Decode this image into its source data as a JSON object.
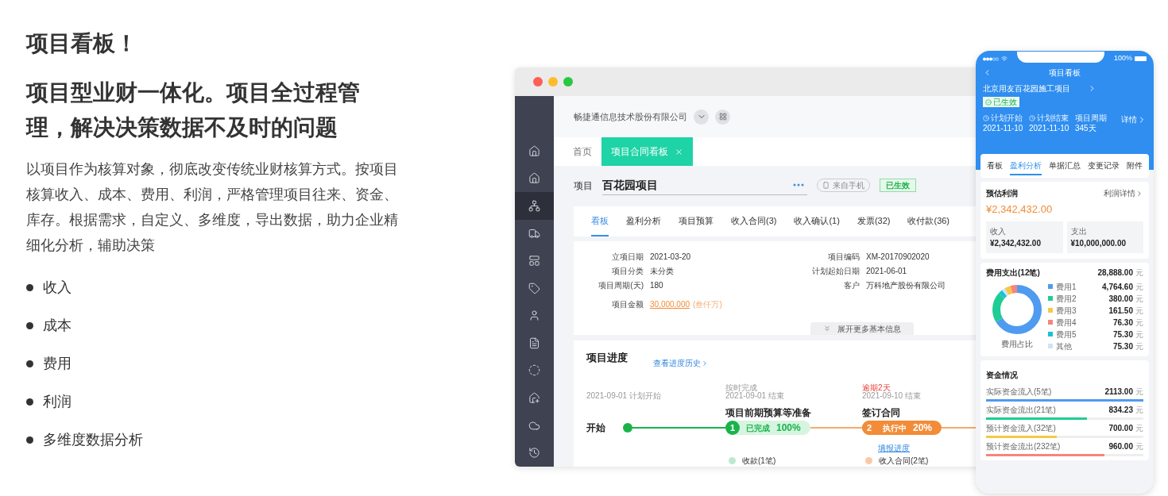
{
  "intro": {
    "title": "项目看板！",
    "subtitle": "项目型业财一体化。项目全过程管理，解决决策数据不及时的问题",
    "description": "以项目作为核算对象，彻底改变传统业财核算方式。按项目核算收入、成本、费用、利润，严格管理项目往来、资金、库存。根据需求，自定义、多维度，导出数据，助力企业精细化分析，辅助决策",
    "bullets": [
      "收入",
      "成本",
      "费用",
      "利润",
      "多维度数据分析"
    ]
  },
  "desktop": {
    "company": "畅捷通信息技术股份有限公司",
    "sidebar": [
      {
        "selected": false
      },
      {
        "selected": false
      },
      {
        "selected": true
      },
      {
        "selected": false
      },
      {
        "selected": false
      },
      {
        "selected": false
      },
      {
        "selected": false
      },
      {
        "selected": false
      },
      {
        "selected": false
      },
      {
        "selected": false
      },
      {
        "selected": false
      },
      {
        "selected": false
      }
    ],
    "tabs": [
      {
        "label": "首页",
        "selected": false,
        "closable": false
      },
      {
        "label": "项目合同看板",
        "selected": true,
        "closable": true
      }
    ],
    "project": {
      "label": "项目",
      "name": "百花园项目",
      "source": "来自手机",
      "status": "已生效"
    },
    "sections": [
      {
        "label": "看板",
        "selected": true
      },
      {
        "label": "盈利分析",
        "selected": false
      },
      {
        "label": "项目预算",
        "selected": false
      },
      {
        "label": "收入合同(3)",
        "selected": false
      },
      {
        "label": "收入确认(1)",
        "selected": false
      },
      {
        "label": "发票(32)",
        "selected": false
      },
      {
        "label": "收付款(36)",
        "selected": false
      }
    ],
    "left_fields": [
      {
        "label": "立项日期",
        "value": "2021-03-20"
      },
      {
        "label": "项目分类",
        "value": "未分类"
      },
      {
        "label": "项目周期(天)",
        "value": "180"
      }
    ],
    "amount": {
      "label": "项目金额",
      "value": "30,000,000",
      "note": "(叁仟万)"
    },
    "right_fields": [
      {
        "label": "项目编码",
        "value": "XM-20170902020"
      },
      {
        "label": "计划起始日期",
        "value": "2021-06-01"
      },
      {
        "label": "客户",
        "value": "万科地产股份有限公司"
      }
    ],
    "expand": "展开更多基本信息",
    "progress": {
      "title": "项目进度",
      "history_link": "查看进度历史",
      "stages": [
        {
          "kind": "start",
          "date": "2021-09-01 计划开始",
          "name": "开始"
        },
        {
          "kind": "done",
          "number": "1",
          "note": "按时完成",
          "date": "2021-09-01 结束",
          "name": "项目前期预算等准备",
          "state": "已完成",
          "percent": "100%",
          "sub": "收款(1笔)"
        },
        {
          "kind": "active",
          "number": "2",
          "note": "逾期2天",
          "date": "2021-09-10 结束",
          "name": "签订合同",
          "state": "执行中",
          "percent": "20%",
          "link": "填报进度",
          "sub": "收入合同(2笔)"
        }
      ]
    }
  },
  "phone": {
    "battery": "100%",
    "title": "项目看板",
    "project": "北京用友百花园施工项目",
    "status": "已生效",
    "dates": [
      {
        "label": "计划开始",
        "value": "2021-11-10"
      },
      {
        "label": "计划结束",
        "value": "2021-11-10"
      },
      {
        "label": "项目周期",
        "value": "345天"
      }
    ],
    "detail": "详情",
    "tabs": [
      {
        "label": "看板",
        "selected": false
      },
      {
        "label": "盈利分析",
        "selected": true
      },
      {
        "label": "单据汇总",
        "selected": false
      },
      {
        "label": "变更记录",
        "selected": false
      },
      {
        "label": "附件",
        "selected": false
      }
    ],
    "profit": {
      "title": "预估利润",
      "link": "利润详情",
      "value": "¥2,342,432.00",
      "income_label": "收入",
      "income": "¥2,342,432.00",
      "expense_label": "支出",
      "expense": "¥10,000,000.00"
    },
    "expenses": {
      "title": "费用支出(12笔)",
      "total": "28,888.00",
      "unit": "元",
      "chart_label": "费用占比",
      "items": [
        {
          "name": "费用1",
          "value": "4,764.60",
          "unit": "元",
          "color": "#4f9bf0"
        },
        {
          "name": "费用2",
          "value": "380.00",
          "unit": "元",
          "color": "#1fcc94"
        },
        {
          "name": "费用3",
          "value": "161.50",
          "unit": "元",
          "color": "#f7c844"
        },
        {
          "name": "费用4",
          "value": "76.30",
          "unit": "元",
          "color": "#f5857e"
        },
        {
          "name": "费用5",
          "value": "75.30",
          "unit": "元",
          "color": "#17c2d6"
        },
        {
          "name": "其他",
          "value": "75.30",
          "unit": "元",
          "color": "#cfe2f7"
        }
      ]
    },
    "funds": {
      "title": "资金情况",
      "items": [
        {
          "label": "实际资金流入(5笔)",
          "value": "2113.00",
          "unit": "元",
          "level": 1,
          "color": "#4f9bf0"
        },
        {
          "label": "实际资金流出(21笔)",
          "value": "834.23",
          "unit": "元",
          "level": 0.64,
          "color": "#1fcc94"
        },
        {
          "label": "预计资金流入(32笔)",
          "value": "700.00",
          "unit": "元",
          "level": 0.45,
          "color": "#f7c844"
        },
        {
          "label": "预计资金流出(232笔)",
          "value": "960.00",
          "unit": "元",
          "level": 0.75,
          "color": "#f5857e"
        }
      ]
    }
  }
}
